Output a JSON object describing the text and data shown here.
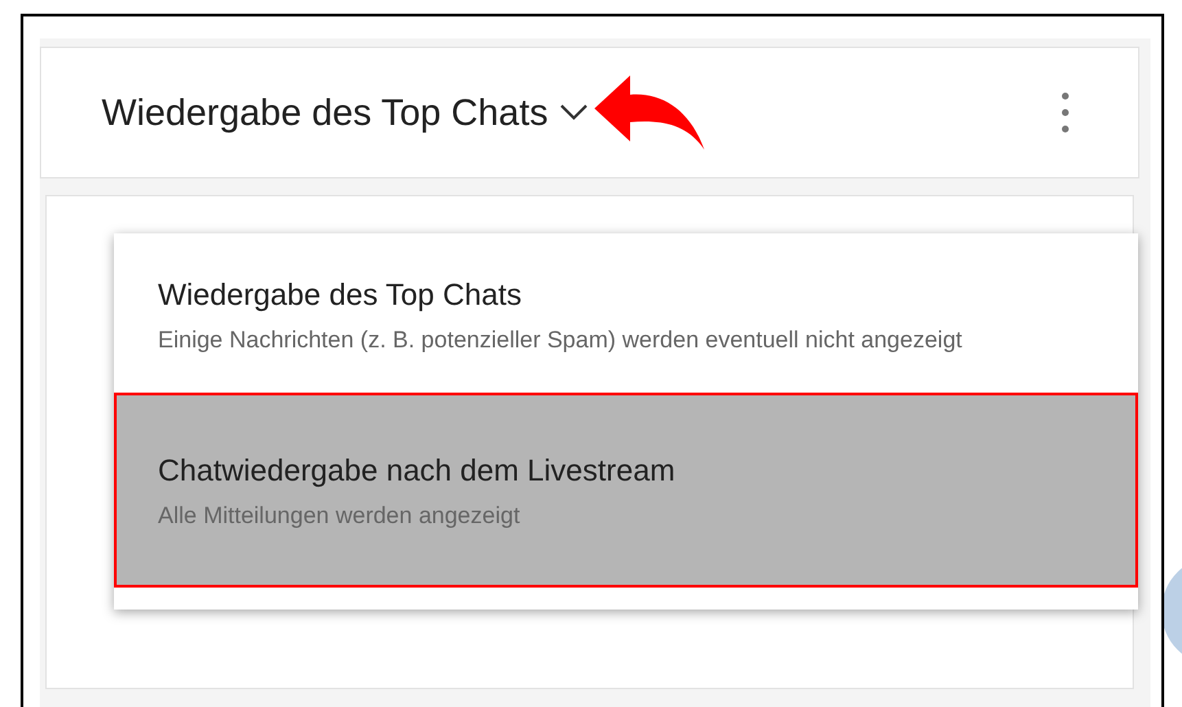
{
  "header": {
    "title": "Wiedergabe des Top Chats"
  },
  "menu": {
    "items": [
      {
        "title": "Wiedergabe des Top Chats",
        "description": "Einige Nachrichten (z. B. potenzieller Spam) werden eventuell nicht angezeigt",
        "selected": false
      },
      {
        "title": "Chatwiedergabe nach dem Livestream",
        "description": "Alle Mitteilungen werden angezeigt",
        "selected": true
      }
    ]
  }
}
